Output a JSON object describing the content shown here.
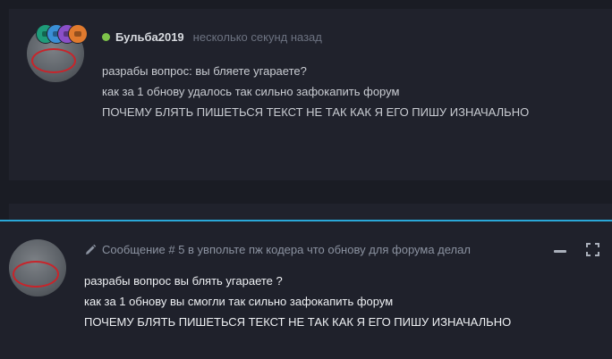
{
  "post": {
    "author": "Бульба2019",
    "time": "несколько секунд назад",
    "lines": [
      "разрабы вопрос: вы бляете угараете?",
      "как за 1 обнову удалось так сильно зафокапить форум",
      "ПОЧЕМУ БЛЯТЬ ПИШЕТЬСЯ ТЕКСТ НЕ ТАК КАК Я ЕГО ПИШУ ИЗНАЧАЛЬНО"
    ],
    "status_color": "#7ec34a"
  },
  "editor": {
    "title": "Сообщение # 5 в увпольте пж кодера что обнову для форума делал",
    "lines": [
      "разрабы вопрос вы блять угараете ?",
      "как за 1 обнову вы смогли так сильно зафокапить форум",
      "ПОЧЕМУ БЛЯТЬ ПИШЕТЬСЯ ТЕКСТ НЕ ТАК КАК Я ЕГО ПИШУ ИЗНАЧАЛЬНО"
    ],
    "accent_color": "#2aa8d8",
    "icons": [
      "pencil-icon",
      "minimize-icon",
      "maximize-icon"
    ]
  }
}
